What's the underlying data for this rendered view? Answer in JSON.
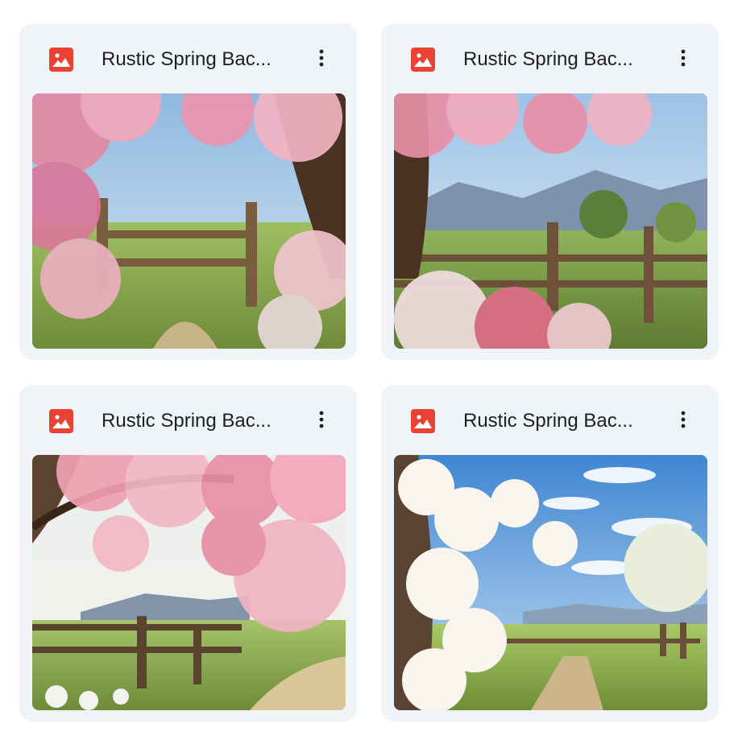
{
  "files": [
    {
      "title": "Rustic Spring Bac...",
      "icon": "image-file-icon",
      "thumbnail": "spring orchard path with wooden fence"
    },
    {
      "title": "Rustic Spring Bac...",
      "icon": "image-file-icon",
      "thumbnail": "blossom tree over fence with mountains"
    },
    {
      "title": "Rustic Spring Bac...",
      "icon": "image-file-icon",
      "thumbnail": "pink blossom canopy over rustic fence"
    },
    {
      "title": "Rustic Spring Bac...",
      "icon": "image-file-icon",
      "thumbnail": "white blossoms beside country path"
    }
  ],
  "colors": {
    "card_bg": "#f0f4f9",
    "image_icon": "#ea4335",
    "text": "#1f1f1f"
  }
}
